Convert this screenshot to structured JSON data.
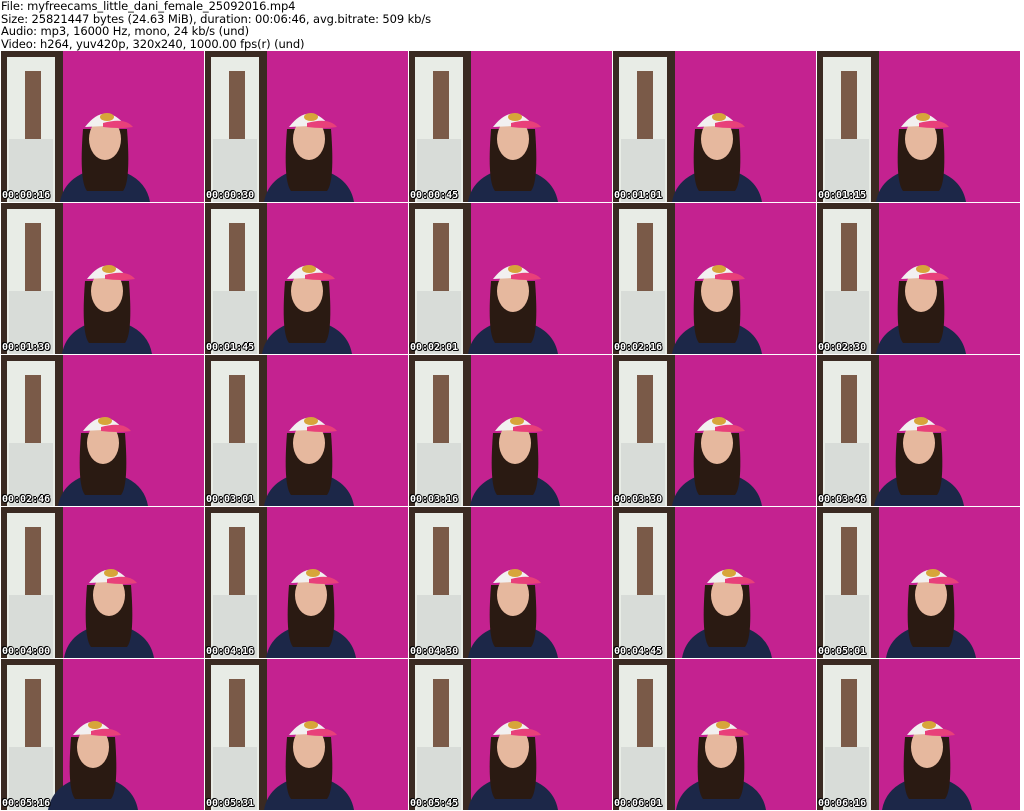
{
  "header": {
    "file_line": "File: myfreecams_little_dani_female_25092016.mp4",
    "size_line": "Size: 25821447 bytes (24.63 MiB), duration: 00:06:46, avg.bitrate: 509 kb/s",
    "audio_line": "Audio: mp3, 16000 Hz, mono, 24 kb/s (und)",
    "video_line": "Video: h264, yuv420p, 320x240, 1000.00 fps(r) (und)"
  },
  "thumbnails": [
    {
      "timestamp": "00:00:16"
    },
    {
      "timestamp": "00:00:30"
    },
    {
      "timestamp": "00:00:45"
    },
    {
      "timestamp": "00:01:01"
    },
    {
      "timestamp": "00:01:15"
    },
    {
      "timestamp": "00:01:30"
    },
    {
      "timestamp": "00:01:45"
    },
    {
      "timestamp": "00:02:01"
    },
    {
      "timestamp": "00:02:16"
    },
    {
      "timestamp": "00:02:30"
    },
    {
      "timestamp": "00:02:46"
    },
    {
      "timestamp": "00:03:01"
    },
    {
      "timestamp": "00:03:16"
    },
    {
      "timestamp": "00:03:30"
    },
    {
      "timestamp": "00:03:46"
    },
    {
      "timestamp": "00:04:00"
    },
    {
      "timestamp": "00:04:16"
    },
    {
      "timestamp": "00:04:30"
    },
    {
      "timestamp": "00:04:45"
    },
    {
      "timestamp": "00:05:01"
    },
    {
      "timestamp": "00:05:16"
    },
    {
      "timestamp": "00:05:31"
    },
    {
      "timestamp": "00:05:45"
    },
    {
      "timestamp": "00:06:01"
    },
    {
      "timestamp": "00:06:16"
    }
  ],
  "colors": {
    "wall": "#c42290",
    "door_frame": "#3a2a22",
    "doorway": "#e8ece6",
    "cap": "#f2f0f0",
    "cap_brim": "#e8407a",
    "hair": "#2a1a12",
    "skin": "#e6b89e",
    "shirt": "#1c2748"
  }
}
